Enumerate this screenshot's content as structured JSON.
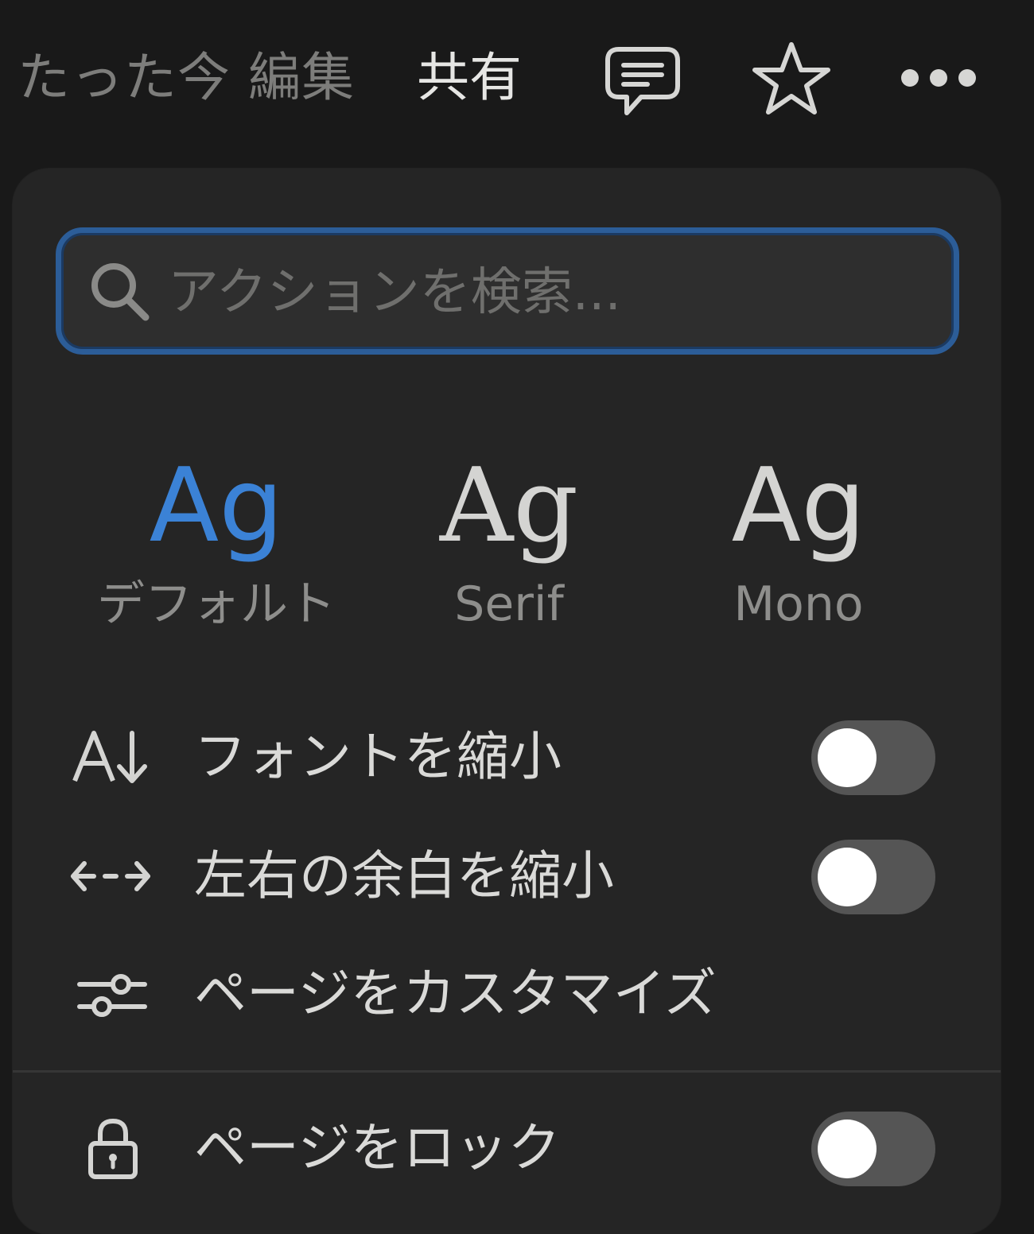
{
  "header": {
    "edited_status": "たった今 編集",
    "share_label": "共有",
    "icons": {
      "comment": "comment-icon",
      "favorite": "star-icon",
      "more": "more-horizontal-icon"
    }
  },
  "menu": {
    "search": {
      "placeholder": "アクションを検索..."
    },
    "font_options": [
      {
        "sample": "Ag",
        "label": "デフォルト",
        "selected": true
      },
      {
        "sample": "Ag",
        "label": "Serif",
        "selected": false
      },
      {
        "sample": "Ag",
        "label": "Mono",
        "selected": false
      }
    ],
    "items": [
      {
        "icon": "font-size-down-icon",
        "label": "フォントを縮小",
        "toggle": false
      },
      {
        "icon": "arrows-horizontal-icon",
        "label": "左右の余白を縮小",
        "toggle": false
      },
      {
        "icon": "sliders-icon",
        "label": "ページをカスタマイズ"
      },
      {
        "icon": "lock-icon",
        "label": "ページをロック",
        "toggle": false
      }
    ]
  },
  "colors": {
    "background": "#191919",
    "popup": "#252525",
    "accent": "#3b82d6",
    "search_border": "#2c5d98",
    "toggle_off": "#555555"
  }
}
